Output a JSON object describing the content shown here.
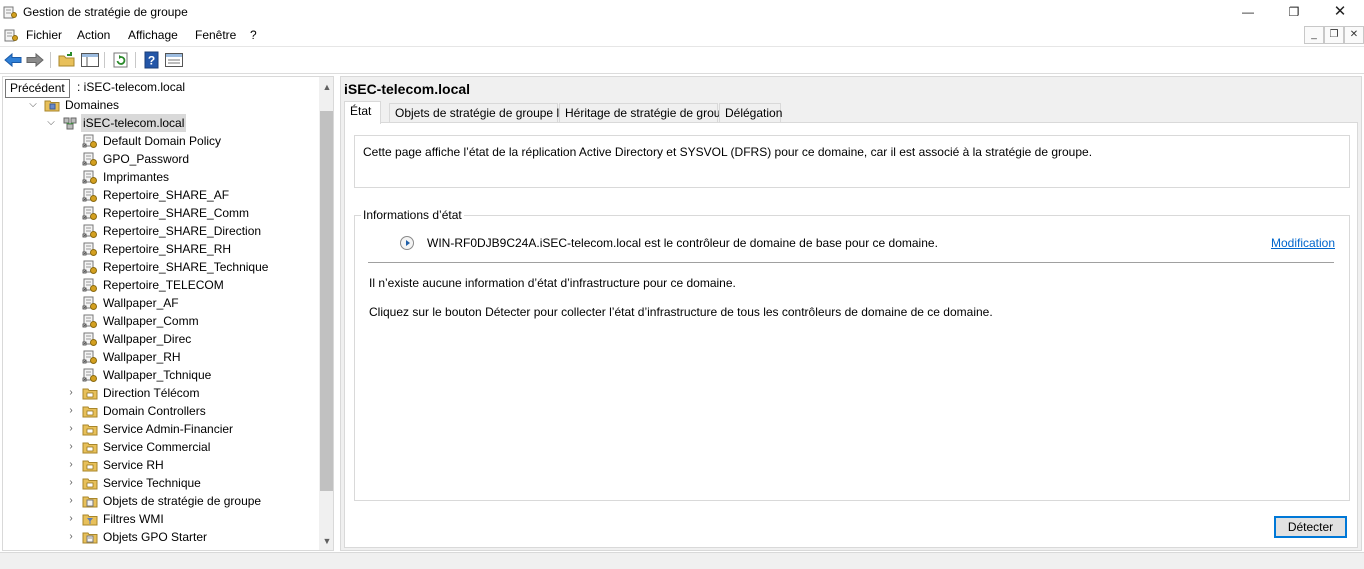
{
  "window": {
    "title": "Gestion de stratégie de groupe",
    "min_glyph": "—",
    "max_glyph": "❐",
    "close_glyph": "✕"
  },
  "menubar": {
    "items": [
      "Fichier",
      "Action",
      "Affichage",
      "Fenêtre",
      "?"
    ],
    "mdi_min_glyph": "_",
    "mdi_restore_glyph": "❐",
    "mdi_close_glyph": "✕"
  },
  "toolbar": {
    "icons": [
      "back-arrow-icon",
      "forward-arrow-icon",
      "up-folder-icon",
      "show-hide-tree-icon",
      "refresh-icon",
      "help-icon",
      "properties-icon"
    ]
  },
  "tooltip": "Précédent",
  "tree": {
    "forest_label_partial": ": iSEC-telecom.local",
    "domaines": "Domaines",
    "domain": "iSEC-telecom.local",
    "gpo_links": [
      "Default Domain Policy",
      "GPO_Password",
      "Imprimantes",
      "Repertoire_SHARE_AF",
      "Repertoire_SHARE_Comm",
      "Repertoire_SHARE_Direction",
      "Repertoire_SHARE_RH",
      "Repertoire_SHARE_Technique",
      "Repertoire_TELECOM",
      "Wallpaper_AF",
      "Wallpaper_Comm",
      "Wallpaper_Direc",
      "Wallpaper_RH",
      "Wallpaper_Tchnique"
    ],
    "ous": [
      "Direction Télécom",
      "Domain Controllers",
      "Service Admin-Financier",
      "Service Commercial",
      "Service RH",
      "Service Technique"
    ],
    "containers": [
      "Objets de stratégie de groupe",
      "Filtres WMI",
      "Objets GPO Starter"
    ]
  },
  "right": {
    "header": "iSEC-telecom.local",
    "tabs": [
      "État",
      "Objets de stratégie de groupe liés",
      "Héritage de stratégie de groupe",
      "Délégation"
    ],
    "active_tab": "État",
    "description": "Cette page affiche l’état de la réplication Active Directory et SYSVOL (DFRS) pour ce domaine, car il est associé à la stratégie de groupe.",
    "group_title": "Informations d’état",
    "dc_text": "WIN-RF0DJB9C24A.iSEC-telecom.local est le contrôleur de domaine de base pour ce domaine.",
    "modify_link": "Modification",
    "no_info_text": "Il n’existe aucune information d’état d’infrastructure pour ce domaine.",
    "instruction_text": "Cliquez sur le bouton Détecter pour collecter l’état d’infrastructure de tous les contrôleurs de domaine de ce domaine.",
    "detect_button": "Détecter"
  }
}
